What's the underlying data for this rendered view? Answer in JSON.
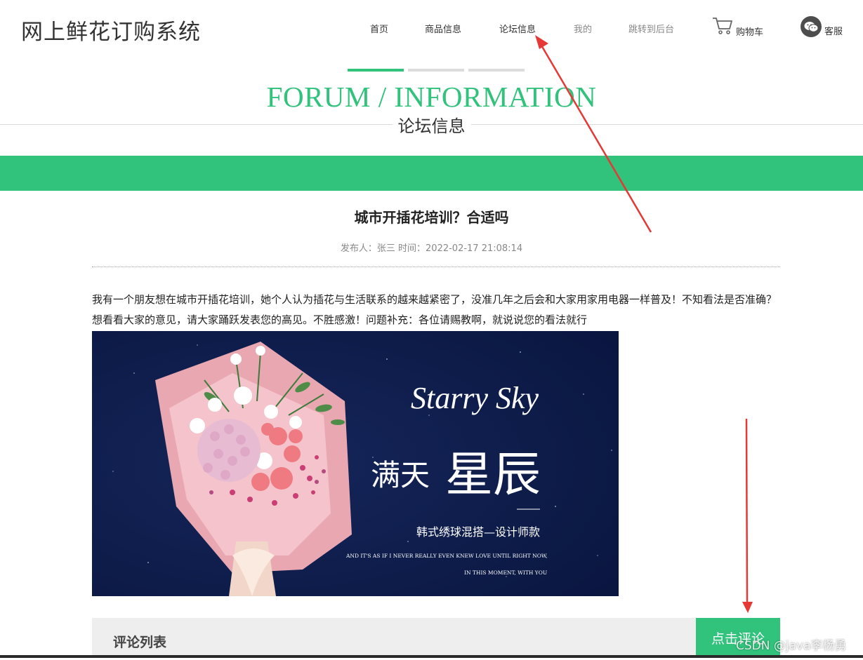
{
  "header": {
    "logo": "网上鲜花订购系统",
    "nav": {
      "home": "首页",
      "products": "商品信息",
      "forum": "论坛信息",
      "mine": "我的",
      "backend": "跳转到后台",
      "cart": "购物车",
      "service": "客服"
    }
  },
  "section": {
    "title_en": "FORUM / INFORMATION",
    "title_cn": "论坛信息"
  },
  "post": {
    "title": "城市开插花培训？合适吗",
    "meta": "发布人：张三 时间：2022-02-17 21:08:14",
    "body": "我有一个朋友想在城市开插花培训，她个人认为插花与生活联系的越来越紧密了，没准几年之后会和大家用家用电器一样普及！不知看法是否准确？想看看大家的意见，请大家踊跃发表您的高见。不胜感激！问题补充：各位请赐教啊，就说说您的看法就行"
  },
  "banner": {
    "script_title": "Starry Sky",
    "headline_small": "满天",
    "headline_large": "星辰",
    "subtitle": "韩式绣球混搭—设计师款",
    "english_line1": "AND IT'S AS IF I NEVER REALLY EVEN KNEW LOVE UNTIL RIGHT NOW,",
    "english_line2": "IN THIS MOMENT, WITH YOU"
  },
  "comments": {
    "list_label": "评论列表",
    "add_button": "点击评论"
  },
  "watermark": "CSDN @java李杨勇",
  "colors": {
    "accent": "#31c27c",
    "banner_bg": "#0f1f4d",
    "annotation": "#e53935"
  }
}
